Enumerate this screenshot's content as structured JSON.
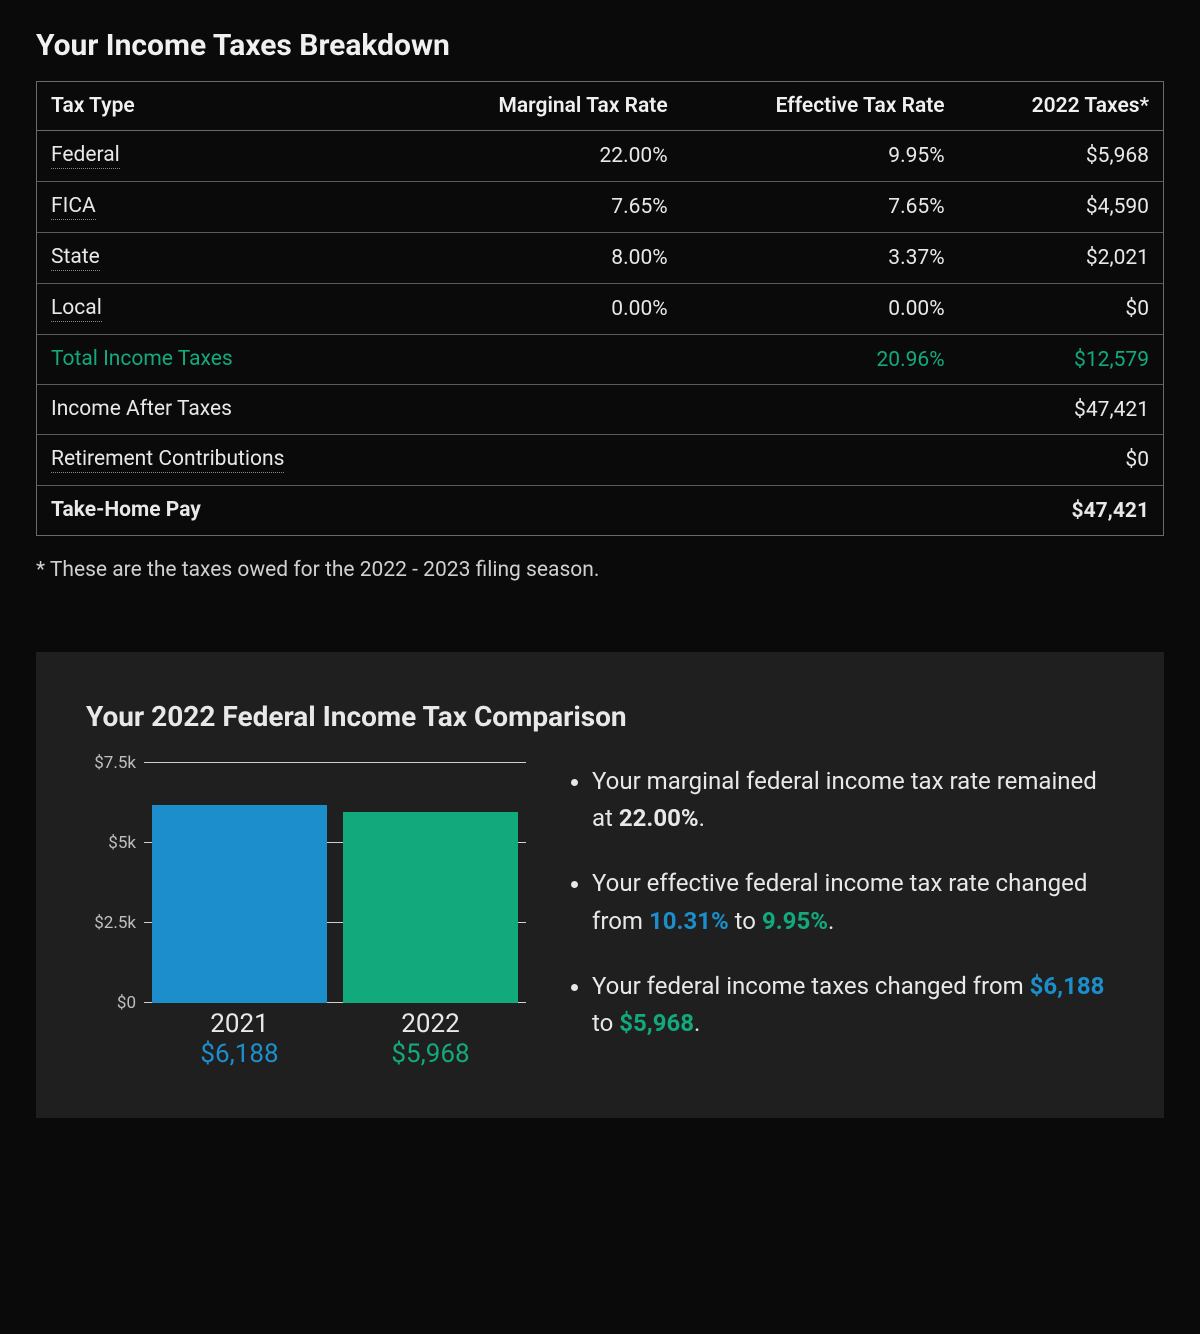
{
  "breakdown": {
    "title": "Your Income Taxes Breakdown",
    "columns": {
      "c0": "Tax Type",
      "c1": "Marginal Tax Rate",
      "c2": "Effective Tax Rate",
      "c3": "2022 Taxes*"
    },
    "rows": {
      "federal": {
        "label": "Federal",
        "marginal": "22.00%",
        "effective": "9.95%",
        "taxes": "$5,968"
      },
      "fica": {
        "label": "FICA",
        "marginal": "7.65%",
        "effective": "7.65%",
        "taxes": "$4,590"
      },
      "state": {
        "label": "State",
        "marginal": "8.00%",
        "effective": "3.37%",
        "taxes": "$2,021"
      },
      "local": {
        "label": "Local",
        "marginal": "0.00%",
        "effective": "0.00%",
        "taxes": "$0"
      },
      "total": {
        "label": "Total Income Taxes",
        "effective": "20.96%",
        "taxes": "$12,579"
      },
      "after": {
        "label": "Income After Taxes",
        "taxes": "$47,421"
      },
      "retirement": {
        "label": "Retirement Contributions",
        "taxes": "$0"
      },
      "takehome": {
        "label": "Take-Home Pay",
        "taxes": "$47,421"
      }
    },
    "footnote": "* These are the taxes owed for the 2022 - 2023 filing season."
  },
  "comparison": {
    "title": "Your 2022 Federal Income Tax Comparison",
    "bullets": {
      "b1_pre": "Your marginal federal income tax rate remained at ",
      "b1_val": "22.00%",
      "b1_post": ".",
      "b2_pre": "Your effective federal income tax rate changed from ",
      "b2_from": "10.31%",
      "b2_mid": " to ",
      "b2_to": "9.95%",
      "b2_post": ".",
      "b3_pre": "Your federal income taxes changed from ",
      "b3_from": "$6,188",
      "b3_mid": " to ",
      "b3_to": "$5,968",
      "b3_post": "."
    },
    "y_ticks": {
      "t0": "$0",
      "t1": "$2.5k",
      "t2": "$5k",
      "t3": "$7.5k"
    },
    "x": {
      "cat0": "2021",
      "val0": "$6,188",
      "cat1": "2022",
      "val1": "$5,968"
    }
  },
  "colors": {
    "blue": "#1b8ecb",
    "green": "#12a97c"
  },
  "chart_data": {
    "type": "bar",
    "title": "Your 2022 Federal Income Tax Comparison",
    "categories": [
      "2021",
      "2022"
    ],
    "values": [
      6188,
      5968
    ],
    "colors": [
      "#1b8ecb",
      "#12a97c"
    ],
    "ylabel": "",
    "xlabel": "",
    "ylim": [
      0,
      7500
    ],
    "y_ticks": [
      0,
      2500,
      5000,
      7500
    ],
    "y_tick_labels": [
      "$0",
      "$2.5k",
      "$5k",
      "$7.5k"
    ],
    "value_labels": [
      "$6,188",
      "$5,968"
    ]
  }
}
